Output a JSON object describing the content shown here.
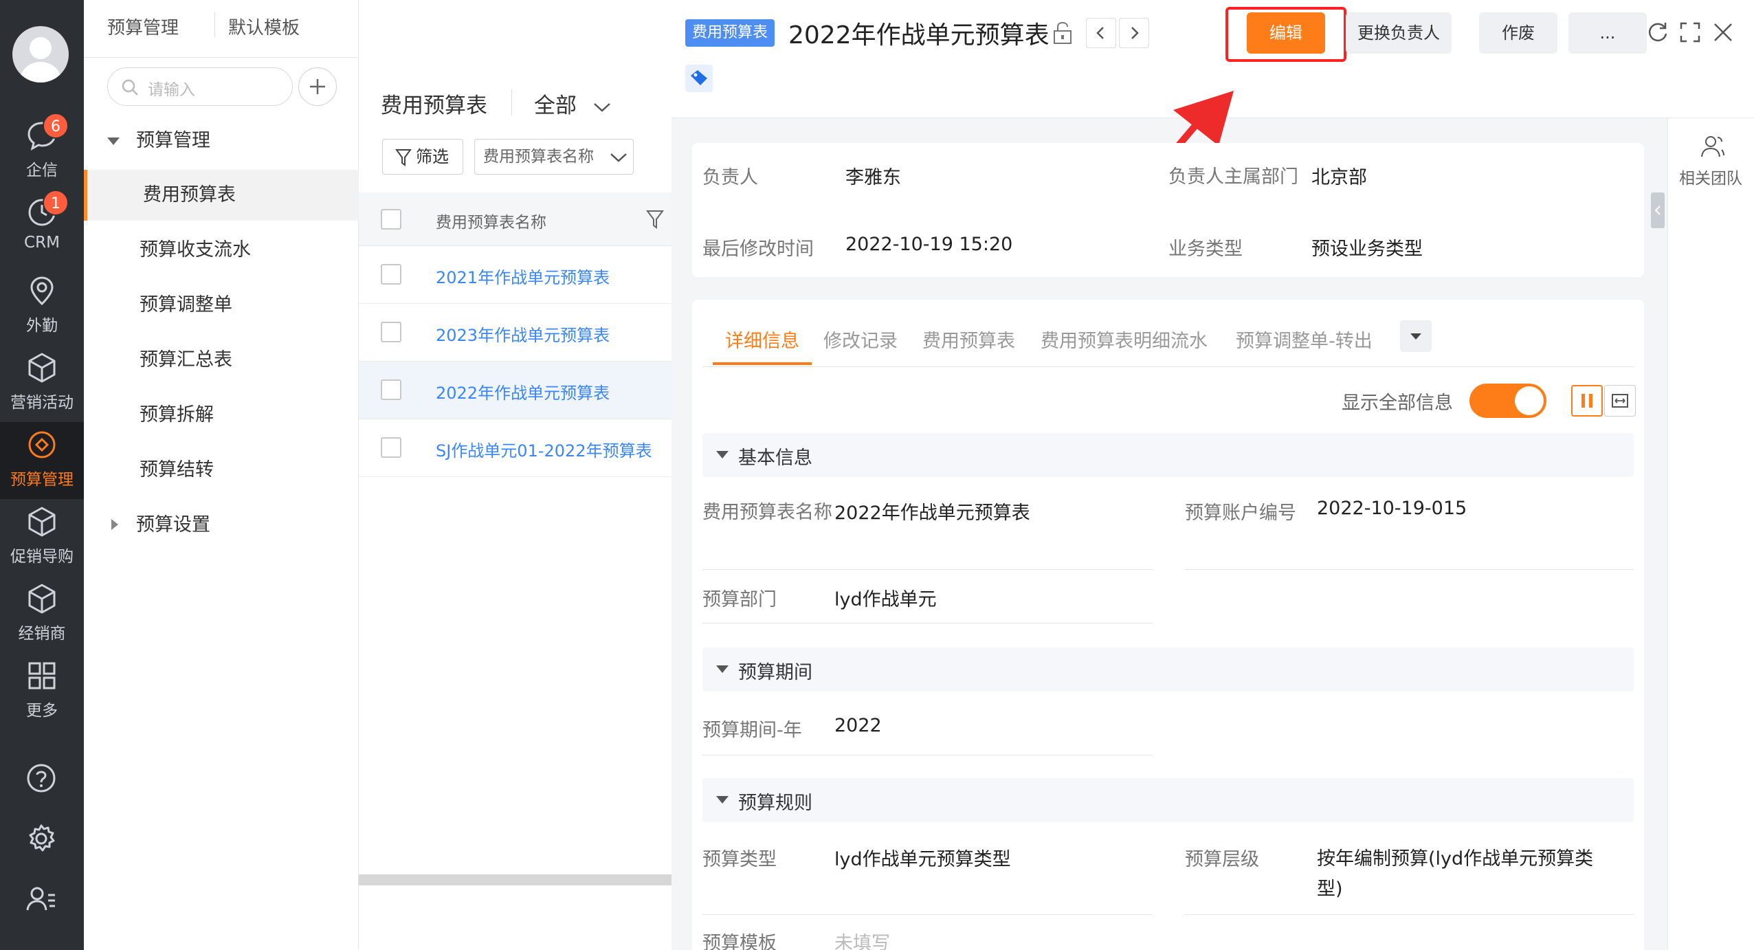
{
  "nav": {
    "items": [
      {
        "label": "企信",
        "badge": "6",
        "icon": "chat-bubble-icon"
      },
      {
        "label": "CRM",
        "badge": "1",
        "icon": "clock-icon"
      },
      {
        "label": "外勤",
        "icon": "location-pin-icon"
      },
      {
        "label": "营销活动",
        "icon": "cube-icon"
      },
      {
        "label": "预算管理",
        "icon": "budget-icon",
        "active": true
      },
      {
        "label": "促销导购",
        "icon": "cube-icon"
      },
      {
        "label": "经销商",
        "icon": "cube-icon"
      },
      {
        "label": "更多",
        "icon": "grid-icon"
      }
    ],
    "active_color": "#ff7a1a"
  },
  "sidebar": {
    "tab1": "预算管理",
    "tab2": "默认模板",
    "search_placeholder": "请输入",
    "group": "预算管理",
    "items": [
      "费用预算表",
      "预算收支流水",
      "预算调整单",
      "预算汇总表",
      "预算拆解",
      "预算结转"
    ],
    "settings": "预算设置"
  },
  "list": {
    "title": "费用预算表",
    "scope": "全部",
    "filter_label": "筛选",
    "field_select": "费用预算表名称",
    "column_header": "费用预算表名称",
    "rows": [
      "2021年作战单元预算表",
      "2023年作战单元预算表",
      "2022年作战单元预算表",
      "SJ作战单元01-2022年预算表"
    ]
  },
  "detail": {
    "object_tag": "费用预算表",
    "title": "2022年作战单元预算表",
    "buttons": {
      "edit": "编辑",
      "change_owner": "更换负责人",
      "void": "作废",
      "more": "..."
    },
    "summary": {
      "owner_label": "负责人",
      "owner": "李雅东",
      "dept_label": "负责人主属部门",
      "dept": "北京部",
      "modified_label": "最后修改时间",
      "modified": "2022-10-19 15:20",
      "biz_label": "业务类型",
      "biz": "预设业务类型"
    },
    "tabs": [
      "详细信息",
      "修改记录",
      "费用预算表",
      "费用预算表明细流水",
      "预算调整单-转出"
    ],
    "show_all_label": "显示全部信息",
    "sections": {
      "basic": "基本信息",
      "period": "预算期间",
      "rules": "预算规则"
    },
    "fields": {
      "name_label": "费用预算表名称",
      "name": "2022年作战单元预算表",
      "account_label": "预算账户编号",
      "account": "2022-10-19-015",
      "dept_label": "预算部门",
      "dept": "lyd作战单元",
      "year_label": "预算期间-年",
      "year": "2022",
      "type_label": "预算类型",
      "type": "lyd作战单元预算类型",
      "level_label": "预算层级",
      "level": "按年编制预算(lyd作战单元预算类型)",
      "template_label": "预算模板",
      "template": "未填写"
    },
    "related_team": "相关团队",
    "accent": "#ff7d18",
    "link_color": "#3a86ff"
  }
}
